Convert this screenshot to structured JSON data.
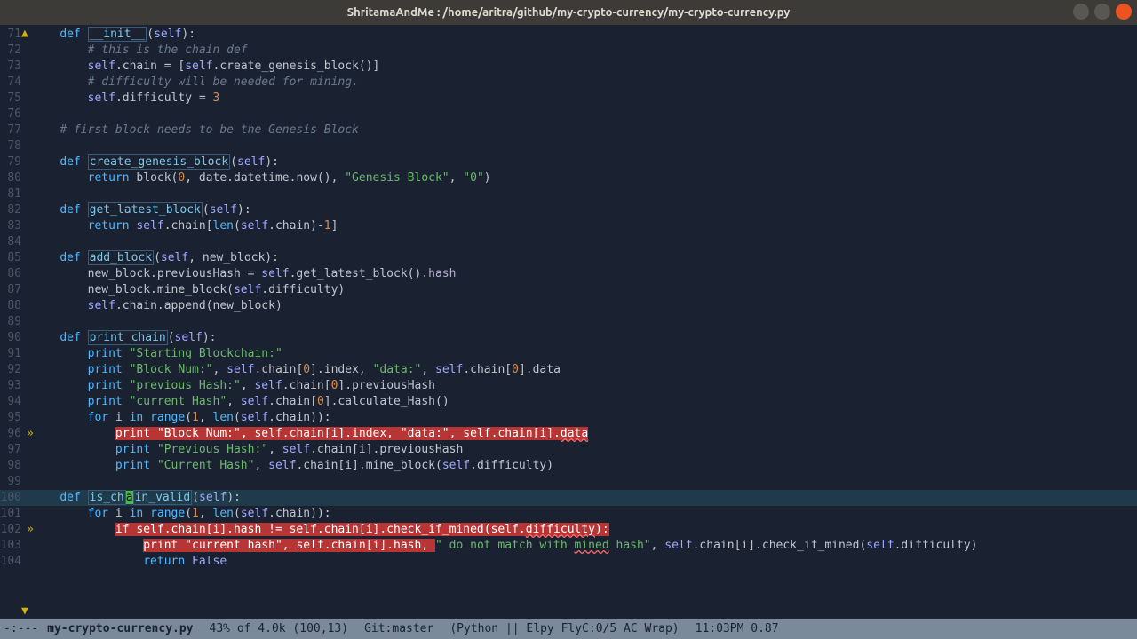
{
  "window": {
    "title": "ShritamaAndMe : /home/aritra/github/my-crypto-currency/my-crypto-currency.py"
  },
  "modeline": {
    "prefix": "-:---",
    "filename": "my-crypto-currency.py",
    "position": "43% of 4.0k (100,13)",
    "git": "Git:master",
    "mode": "(Python || Elpy FlyC:0/5 AC Wrap)",
    "time": "11:03PM 0.87"
  },
  "lines": [
    {
      "num": "71",
      "mark": "",
      "seg": [
        {
          "t": "    ",
          "c": ""
        },
        {
          "t": "def",
          "c": "kw"
        },
        {
          "t": " ",
          "c": ""
        },
        {
          "t": "__init__",
          "c": "fn"
        },
        {
          "t": "(",
          "c": "op"
        },
        {
          "t": "self",
          "c": "self"
        },
        {
          "t": "):",
          "c": "op"
        }
      ]
    },
    {
      "num": "72",
      "mark": "",
      "seg": [
        {
          "t": "        ",
          "c": ""
        },
        {
          "t": "# this is the chain def",
          "c": "comment"
        }
      ]
    },
    {
      "num": "73",
      "mark": "",
      "seg": [
        {
          "t": "        ",
          "c": ""
        },
        {
          "t": "self",
          "c": "self"
        },
        {
          "t": ".chain = [",
          "c": "op"
        },
        {
          "t": "self",
          "c": "self"
        },
        {
          "t": ".create_genesis_block()]",
          "c": "op"
        }
      ]
    },
    {
      "num": "74",
      "mark": "",
      "seg": [
        {
          "t": "        ",
          "c": ""
        },
        {
          "t": "# difficulty will be needed for mining.",
          "c": "comment"
        }
      ]
    },
    {
      "num": "75",
      "mark": "",
      "seg": [
        {
          "t": "        ",
          "c": ""
        },
        {
          "t": "self",
          "c": "self"
        },
        {
          "t": ".difficulty = ",
          "c": "op"
        },
        {
          "t": "3",
          "c": "num"
        }
      ]
    },
    {
      "num": "76",
      "mark": "",
      "seg": []
    },
    {
      "num": "77",
      "mark": "",
      "seg": [
        {
          "t": "    ",
          "c": ""
        },
        {
          "t": "# first block needs to be the Genesis Block",
          "c": "comment"
        }
      ]
    },
    {
      "num": "78",
      "mark": "",
      "seg": []
    },
    {
      "num": "79",
      "mark": "",
      "seg": [
        {
          "t": "    ",
          "c": ""
        },
        {
          "t": "def",
          "c": "kw"
        },
        {
          "t": " ",
          "c": ""
        },
        {
          "t": "create_genesis_block",
          "c": "fn"
        },
        {
          "t": "(",
          "c": "op"
        },
        {
          "t": "self",
          "c": "self"
        },
        {
          "t": "):",
          "c": "op"
        }
      ]
    },
    {
      "num": "80",
      "mark": "",
      "seg": [
        {
          "t": "        ",
          "c": ""
        },
        {
          "t": "return",
          "c": "kw"
        },
        {
          "t": " block(",
          "c": "op"
        },
        {
          "t": "0",
          "c": "num"
        },
        {
          "t": ", date.datetime.now(), ",
          "c": "op"
        },
        {
          "t": "\"Genesis Block\"",
          "c": "str"
        },
        {
          "t": ", ",
          "c": "op"
        },
        {
          "t": "\"0\"",
          "c": "str"
        },
        {
          "t": ")",
          "c": "op"
        }
      ]
    },
    {
      "num": "81",
      "mark": "",
      "seg": []
    },
    {
      "num": "82",
      "mark": "",
      "seg": [
        {
          "t": "    ",
          "c": ""
        },
        {
          "t": "def",
          "c": "kw"
        },
        {
          "t": " ",
          "c": ""
        },
        {
          "t": "get_latest_block",
          "c": "fn"
        },
        {
          "t": "(",
          "c": "op"
        },
        {
          "t": "self",
          "c": "self"
        },
        {
          "t": "):",
          "c": "op"
        }
      ]
    },
    {
      "num": "83",
      "mark": "",
      "seg": [
        {
          "t": "        ",
          "c": ""
        },
        {
          "t": "return",
          "c": "kw"
        },
        {
          "t": " ",
          "c": ""
        },
        {
          "t": "self",
          "c": "self"
        },
        {
          "t": ".chain[",
          "c": "op"
        },
        {
          "t": "len",
          "c": "kw"
        },
        {
          "t": "(",
          "c": "op"
        },
        {
          "t": "self",
          "c": "self"
        },
        {
          "t": ".chain)-",
          "c": "op"
        },
        {
          "t": "1",
          "c": "num"
        },
        {
          "t": "]",
          "c": "op"
        }
      ]
    },
    {
      "num": "84",
      "mark": "",
      "seg": []
    },
    {
      "num": "85",
      "mark": "",
      "seg": [
        {
          "t": "    ",
          "c": ""
        },
        {
          "t": "def",
          "c": "kw"
        },
        {
          "t": " ",
          "c": ""
        },
        {
          "t": "add_block",
          "c": "fn"
        },
        {
          "t": "(",
          "c": "op"
        },
        {
          "t": "self",
          "c": "self"
        },
        {
          "t": ", new_block):",
          "c": "op"
        }
      ]
    },
    {
      "num": "86",
      "mark": "",
      "seg": [
        {
          "t": "        new_block.previousHash = ",
          "c": "op"
        },
        {
          "t": "self",
          "c": "self"
        },
        {
          "t": ".get_latest_block().",
          "c": "op"
        },
        {
          "t": "hash",
          "c": "prop"
        }
      ]
    },
    {
      "num": "87",
      "mark": "",
      "seg": [
        {
          "t": "        new_block.mine_block(",
          "c": "op"
        },
        {
          "t": "self",
          "c": "self"
        },
        {
          "t": ".difficulty)",
          "c": "op"
        }
      ]
    },
    {
      "num": "88",
      "mark": "",
      "seg": [
        {
          "t": "        ",
          "c": ""
        },
        {
          "t": "self",
          "c": "self"
        },
        {
          "t": ".chain.append(new_block)",
          "c": "op"
        }
      ]
    },
    {
      "num": "89",
      "mark": "",
      "seg": []
    },
    {
      "num": "90",
      "mark": "",
      "seg": [
        {
          "t": "    ",
          "c": ""
        },
        {
          "t": "def",
          "c": "kw"
        },
        {
          "t": " ",
          "c": ""
        },
        {
          "t": "print_chain",
          "c": "fn"
        },
        {
          "t": "(",
          "c": "op"
        },
        {
          "t": "self",
          "c": "self"
        },
        {
          "t": "):",
          "c": "op"
        }
      ]
    },
    {
      "num": "91",
      "mark": "",
      "seg": [
        {
          "t": "        ",
          "c": ""
        },
        {
          "t": "print",
          "c": "kw"
        },
        {
          "t": " ",
          "c": ""
        },
        {
          "t": "\"Starting Blockchain:\"",
          "c": "str"
        }
      ]
    },
    {
      "num": "92",
      "mark": "",
      "seg": [
        {
          "t": "        ",
          "c": ""
        },
        {
          "t": "print",
          "c": "kw"
        },
        {
          "t": " ",
          "c": ""
        },
        {
          "t": "\"Block Num:\"",
          "c": "str"
        },
        {
          "t": ", ",
          "c": "op"
        },
        {
          "t": "self",
          "c": "self"
        },
        {
          "t": ".chain[",
          "c": "op"
        },
        {
          "t": "0",
          "c": "num"
        },
        {
          "t": "].index, ",
          "c": "op"
        },
        {
          "t": "\"data:\"",
          "c": "str"
        },
        {
          "t": ", ",
          "c": "op"
        },
        {
          "t": "self",
          "c": "self"
        },
        {
          "t": ".chain[",
          "c": "op"
        },
        {
          "t": "0",
          "c": "num"
        },
        {
          "t": "].data",
          "c": "op"
        }
      ]
    },
    {
      "num": "93",
      "mark": "",
      "seg": [
        {
          "t": "        ",
          "c": ""
        },
        {
          "t": "print",
          "c": "kw"
        },
        {
          "t": " ",
          "c": ""
        },
        {
          "t": "\"previous Hash:\"",
          "c": "str"
        },
        {
          "t": ", ",
          "c": "op"
        },
        {
          "t": "self",
          "c": "self"
        },
        {
          "t": ".chain[",
          "c": "op"
        },
        {
          "t": "0",
          "c": "num"
        },
        {
          "t": "].previousHash",
          "c": "op"
        }
      ]
    },
    {
      "num": "94",
      "mark": "",
      "seg": [
        {
          "t": "        ",
          "c": ""
        },
        {
          "t": "print",
          "c": "kw"
        },
        {
          "t": " ",
          "c": ""
        },
        {
          "t": "\"current Hash\"",
          "c": "str"
        },
        {
          "t": ", ",
          "c": "op"
        },
        {
          "t": "self",
          "c": "self"
        },
        {
          "t": ".chain[",
          "c": "op"
        },
        {
          "t": "0",
          "c": "num"
        },
        {
          "t": "].calculate_Hash()",
          "c": "op"
        }
      ]
    },
    {
      "num": "95",
      "mark": "",
      "seg": [
        {
          "t": "        ",
          "c": ""
        },
        {
          "t": "for",
          "c": "kw"
        },
        {
          "t": " i ",
          "c": "op"
        },
        {
          "t": "in",
          "c": "kw"
        },
        {
          "t": " ",
          "c": ""
        },
        {
          "t": "range",
          "c": "kw"
        },
        {
          "t": "(",
          "c": "op"
        },
        {
          "t": "1",
          "c": "num"
        },
        {
          "t": ", ",
          "c": "op"
        },
        {
          "t": "len",
          "c": "kw"
        },
        {
          "t": "(",
          "c": "op"
        },
        {
          "t": "self",
          "c": "self"
        },
        {
          "t": ".chain)):",
          "c": "op"
        }
      ]
    },
    {
      "num": "96",
      "mark": "»",
      "seg": [
        {
          "t": "            ",
          "c": ""
        },
        {
          "t": "print",
          "c": "hl-err"
        },
        {
          "t": " ",
          "c": "hl-err"
        },
        {
          "t": "\"Block Num:\"",
          "c": "hl-err"
        },
        {
          "t": ", ",
          "c": "hl-err"
        },
        {
          "t": "self",
          "c": "hl-err"
        },
        {
          "t": ".chain[i].index, ",
          "c": "hl-err"
        },
        {
          "t": "\"data:\"",
          "c": "hl-err"
        },
        {
          "t": ", ",
          "c": "hl-err"
        },
        {
          "t": "self",
          "c": "hl-err"
        },
        {
          "t": ".chain[i].",
          "c": "hl-err"
        },
        {
          "t": "data",
          "c": "hl-err underline-err"
        }
      ]
    },
    {
      "num": "97",
      "mark": "",
      "seg": [
        {
          "t": "            ",
          "c": ""
        },
        {
          "t": "print",
          "c": "kw"
        },
        {
          "t": " ",
          "c": ""
        },
        {
          "t": "\"Previous Hash:\"",
          "c": "str"
        },
        {
          "t": ", ",
          "c": "op"
        },
        {
          "t": "self",
          "c": "self"
        },
        {
          "t": ".chain[i].previousHash",
          "c": "op"
        }
      ]
    },
    {
      "num": "98",
      "mark": "",
      "seg": [
        {
          "t": "            ",
          "c": ""
        },
        {
          "t": "print",
          "c": "kw"
        },
        {
          "t": " ",
          "c": ""
        },
        {
          "t": "\"Current Hash\"",
          "c": "str"
        },
        {
          "t": ", ",
          "c": "op"
        },
        {
          "t": "self",
          "c": "self"
        },
        {
          "t": ".chain[i].mine_block(",
          "c": "op"
        },
        {
          "t": "self",
          "c": "self"
        },
        {
          "t": ".difficulty)",
          "c": "op"
        }
      ]
    },
    {
      "num": "99",
      "mark": "",
      "seg": []
    },
    {
      "num": "100",
      "mark": "",
      "current": true,
      "seg": [
        {
          "t": "    ",
          "c": ""
        },
        {
          "t": "def",
          "c": "kw"
        },
        {
          "t": " ",
          "c": ""
        },
        {
          "t": "is_ch",
          "c": "fn"
        },
        {
          "t": "a",
          "c": "cursor"
        },
        {
          "t": "in_valid",
          "c": "fn"
        },
        {
          "t": "(",
          "c": "op"
        },
        {
          "t": "self",
          "c": "self"
        },
        {
          "t": "):",
          "c": "op"
        }
      ]
    },
    {
      "num": "101",
      "mark": "",
      "seg": [
        {
          "t": "        ",
          "c": ""
        },
        {
          "t": "for",
          "c": "kw"
        },
        {
          "t": " i ",
          "c": "op"
        },
        {
          "t": "in",
          "c": "kw"
        },
        {
          "t": " ",
          "c": ""
        },
        {
          "t": "range",
          "c": "kw"
        },
        {
          "t": "(",
          "c": "op"
        },
        {
          "t": "1",
          "c": "num"
        },
        {
          "t": ", ",
          "c": "op"
        },
        {
          "t": "len",
          "c": "kw"
        },
        {
          "t": "(",
          "c": "op"
        },
        {
          "t": "self",
          "c": "self"
        },
        {
          "t": ".chain)):",
          "c": "op"
        }
      ]
    },
    {
      "num": "102",
      "mark": "»",
      "seg": [
        {
          "t": "            ",
          "c": ""
        },
        {
          "t": "if",
          "c": "hl-err"
        },
        {
          "t": " ",
          "c": "hl-err"
        },
        {
          "t": "self",
          "c": "hl-err"
        },
        {
          "t": ".chain[i].hash != ",
          "c": "hl-err"
        },
        {
          "t": "self",
          "c": "hl-err"
        },
        {
          "t": ".chain[i].check_if_mined(",
          "c": "hl-err"
        },
        {
          "t": "self",
          "c": "hl-err"
        },
        {
          "t": ".",
          "c": "hl-err"
        },
        {
          "t": "difficulty",
          "c": "hl-err underline-err"
        },
        {
          "t": "):",
          "c": "hl-err"
        }
      ]
    },
    {
      "num": "103",
      "mark": "",
      "seg": [
        {
          "t": "                ",
          "c": ""
        },
        {
          "t": "print",
          "c": "hl-err"
        },
        {
          "t": " ",
          "c": "hl-err"
        },
        {
          "t": "\"current hash\"",
          "c": "hl-err"
        },
        {
          "t": ", ",
          "c": "hl-err"
        },
        {
          "t": "self",
          "c": "hl-err"
        },
        {
          "t": ".chain[i].hash, ",
          "c": "hl-err"
        },
        {
          "t": "\" do not match with ",
          "c": "str"
        },
        {
          "t": "mined",
          "c": "str underline-err"
        },
        {
          "t": " hash\"",
          "c": "str"
        },
        {
          "t": ", ",
          "c": "op"
        },
        {
          "t": "self",
          "c": "self"
        },
        {
          "t": ".chain[i].check_if_mined(",
          "c": "op"
        },
        {
          "t": "self",
          "c": "self"
        },
        {
          "t": ".difficulty)",
          "c": "op"
        }
      ]
    },
    {
      "num": "104",
      "mark": "",
      "seg": [
        {
          "t": "                ",
          "c": ""
        },
        {
          "t": "return",
          "c": "kw"
        },
        {
          "t": " ",
          "c": ""
        },
        {
          "t": "False",
          "c": "self"
        }
      ]
    }
  ]
}
